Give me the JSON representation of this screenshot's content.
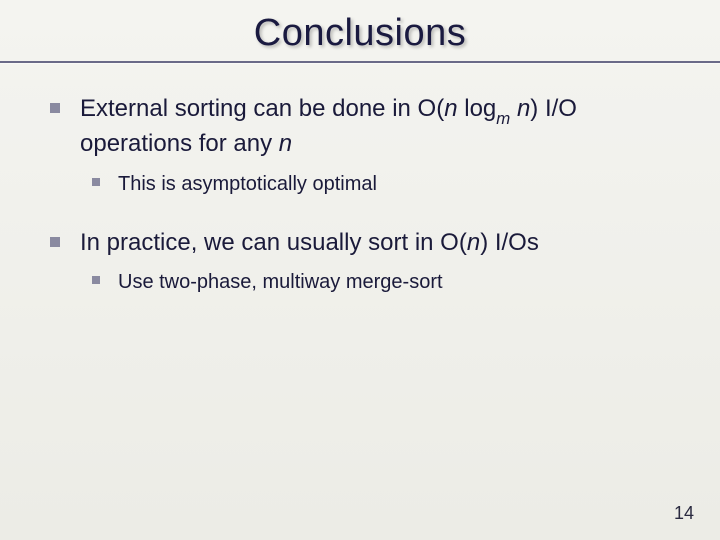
{
  "title": "Conclusions",
  "b1": {
    "pre": "External sorting can be done in O(",
    "n1": "n",
    "log": " log",
    "m": "m",
    "sp": " ",
    "n2": "n",
    "post": ") I/O operations for any ",
    "n3": "n"
  },
  "b1_1": "This is asymptotically optimal",
  "b2": {
    "pre": "In practice, we can usually sort in O(",
    "n": "n",
    "post": ") I/Os"
  },
  "b2_1": "Use two-phase, multiway merge-sort",
  "page": "14"
}
